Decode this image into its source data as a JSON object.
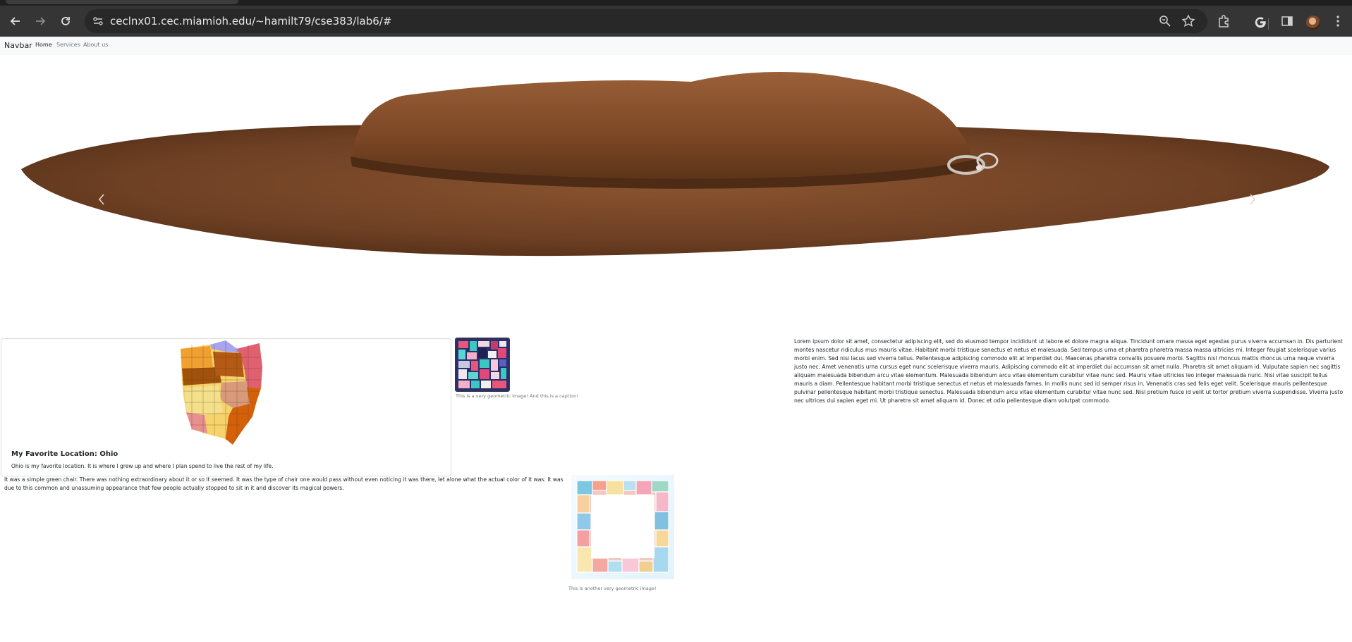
{
  "browser": {
    "url": "ceclnx01.cec.miamioh.edu/~hamilt79/cse383/lab6/#",
    "icons": [
      "back-icon",
      "forward-icon",
      "reload-icon",
      "site-info-icon",
      "zoom-icon",
      "bookmark-star-icon",
      "extensions-icon",
      "google-icon",
      "side-panel-icon",
      "profile-avatar",
      "menu-icon"
    ]
  },
  "navbar": {
    "brand": "Navbar",
    "links": [
      "Home",
      "Services",
      "About us"
    ],
    "active_link": "Home"
  },
  "carousel": {
    "prev_icon": "chevron-left-icon",
    "next_icon": "chevron-right-icon"
  },
  "card": {
    "title": "My Favorite Location: Ohio",
    "text": "Ohio is my favorite location. It is where I grew up and where I plan spend to live the rest of my life."
  },
  "figure1": {
    "caption": "This is a very geometric image! And this is a caption!"
  },
  "lorem": "Lorem ipsum dolor sit amet, consectetur adipiscing elit, sed do eiusmod tempor incididunt ut labore et dolore magna aliqua. Tincidunt ornare massa eget egestas purus viverra accumsan in. Dis parturient montes nascetur ridiculus mus mauris vitae. Habitant morbi tristique senectus et netus et malesuada. Sed tempus urna et pharetra pharetra massa massa ultricies mi. Integer feugiat scelerisque varius morbi enim. Sed nisi lacus sed viverra tellus. Pellentesque adipiscing commodo elit at imperdiet dui. Maecenas pharetra convallis posuere morbi. Sagittis nisl rhoncus mattis rhoncus urna neque viverra justo nec. Amet venenatis urna cursus eget nunc scelerisque viverra mauris. Adipiscing commodo elit at imperdiet dui accumsan sit amet nulla. Pharetra sit amet aliquam id. Vulputate sapien nec sagittis aliquam malesuada bibendum arcu vitae elementum. Malesuada bibendum arcu vitae elementum curabitur vitae nunc sed. Mauris vitae ultricies leo integer malesuada nunc. Nisi vitae suscipit tellus mauris a diam. Pellentesque habitant morbi tristique senectus et netus et malesuada fames. In mollis nunc sed id semper risus in. Venenatis cras sed felis eget velit. Scelerisque mauris pellentesque pulvinar pellentesque habitant morbi tristique senectus. Malesuada bibendum arcu vitae elementum curabitur vitae nunc sed. Nisl pretium fusce id velit ut tortor pretium viverra suspendisse. Viverra justo nec ultrices dui sapien eget mi. Ut pharetra sit amet aliquam id. Donec et odio pellentesque diam volutpat commodo.",
  "chair_text": "It was a simple green chair. There was nothing extraordinary about it or so it seemed. It was the type of chair one would pass without even noticing it was there, let alone what the actual color of it was. It was due to this common and unassuming appearance that few people actually stopped to sit in it and discover its magical powers.",
  "figure2": {
    "caption": "This is another very geometric image!"
  }
}
